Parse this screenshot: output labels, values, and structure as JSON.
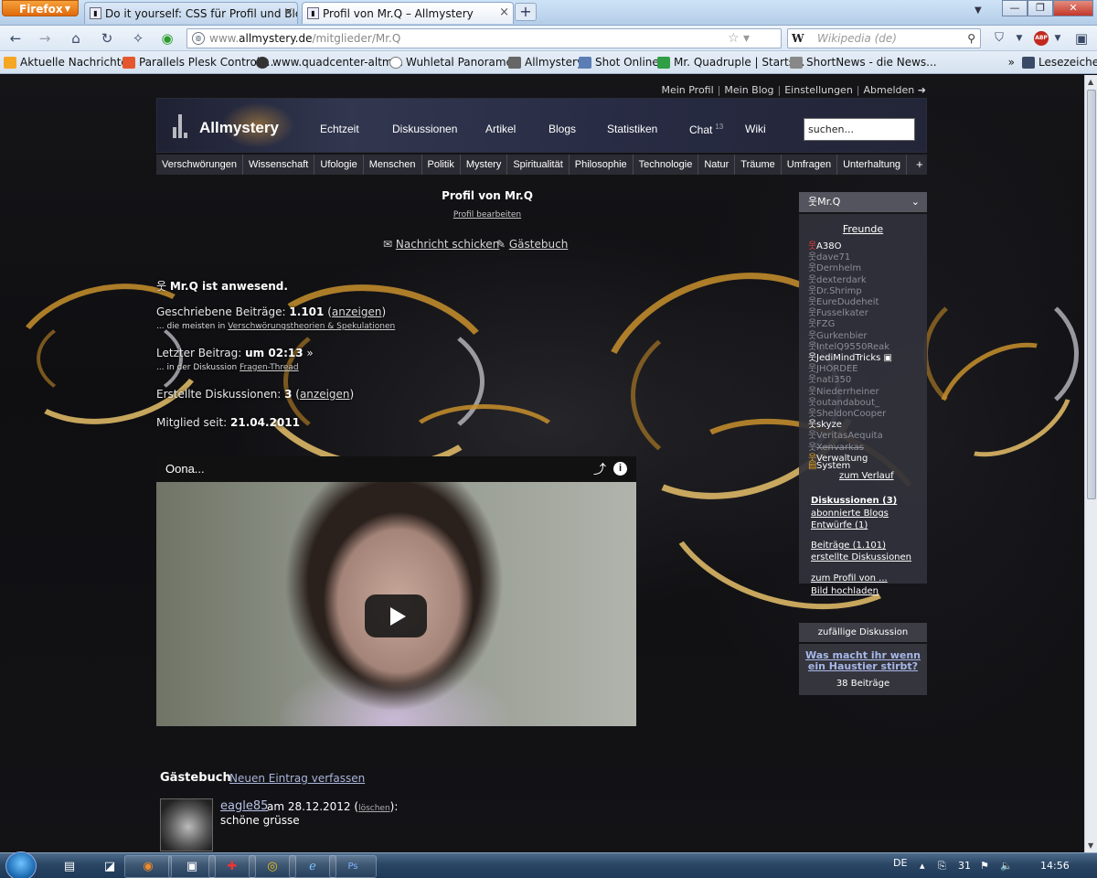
{
  "browser": {
    "menu_label": "Firefox",
    "tabs": [
      {
        "title": "Do it yourself: CSS für Profil und Blog..."
      },
      {
        "title": "Profil von Mr.Q – Allmystery"
      }
    ],
    "url_prefix": "www.",
    "url_domain": "allmystery.de",
    "url_path": "/mitglieder/Mr.Q",
    "search_engine": "W",
    "search_placeholder": "Wikipedia (de)",
    "addon_abp": "ABP",
    "bookmarks": [
      {
        "label": "Aktuelle Nachrichten",
        "color": "#f5a623"
      },
      {
        "label": "Parallels Plesk Control ...",
        "color": "#e4572e"
      },
      {
        "label": "www.quadcenter-altm...",
        "color": "#333333"
      },
      {
        "label": "Wuhletal Panoramen",
        "color": "#777777"
      },
      {
        "label": "Allmystery",
        "color": "#666666"
      },
      {
        "label": "Shot Online",
        "color": "#5b7db5"
      },
      {
        "label": "Mr. Quadruple | Starts...",
        "color": "#2f9e44"
      },
      {
        "label": "ShortNews - die News...",
        "color": "#888888"
      }
    ],
    "bookmarks_more": "»",
    "reading_list": "Lesezeichen"
  },
  "site": {
    "toplinks": [
      "Mein Profil",
      "Mein Blog",
      "Einstellungen",
      "Abmelden ➜"
    ],
    "logo": "Allmystery",
    "nav": [
      {
        "label": "Echtzeit"
      },
      {
        "label": "Diskussionen"
      },
      {
        "label": "Artikel"
      },
      {
        "label": "Blogs"
      },
      {
        "label": "Statistiken"
      },
      {
        "label": "Chat",
        "badge": "13"
      },
      {
        "label": "Wiki"
      }
    ],
    "search_value": "suchen...",
    "categories": [
      "Verschwörungen",
      "Wissenschaft",
      "Ufologie",
      "Menschen",
      "Politik",
      "Mystery",
      "Spiritualität",
      "Philosophie",
      "Technologie",
      "Natur",
      "Träume",
      "Umfragen",
      "Unterhaltung",
      "+"
    ]
  },
  "profile": {
    "title": "Profil von Mr.Q",
    "edit_link": "Profil bearbeiten",
    "message_link": "Nachricht schicken",
    "guestbook_link": "Gästebuch",
    "presence": "Mr.Q ist anwesend.",
    "posts_label": "Geschriebene Beiträge:",
    "posts_value": "1.101",
    "posts_show": "anzeigen",
    "posts_sub_prefix": "... die meisten in",
    "posts_sub_link": "Verschwörungstheorien & Spekulationen",
    "last_post_label": "Letzter Beitrag:",
    "last_post_value": "um 02:13",
    "last_post_sub_prefix": "... in der Diskussion",
    "last_post_sub_link": "Fragen-Thread",
    "threads_label": "Erstellte Diskussionen:",
    "threads_value": "3",
    "threads_show": "anzeigen",
    "member_since_label": "Mitglied seit:",
    "member_since_value": "21.04.2011"
  },
  "video": {
    "title": "Oona...",
    "share_icon": "share-icon",
    "info_icon": "i"
  },
  "guestbook": {
    "heading": "Gästebuch",
    "new_entry": "Neuen Eintrag verfassen",
    "entries": [
      {
        "author": "eagle85",
        "date": "am 28.12.2012",
        "delete": "löschen",
        "text": "schöne grüsse"
      }
    ]
  },
  "sidebar": {
    "user": "Mr.Q",
    "friends_title": "Freunde",
    "friends": [
      {
        "name": "A38O",
        "state": "alert"
      },
      {
        "name": "dave71",
        "state": "off"
      },
      {
        "name": "Dernhelm",
        "state": "off"
      },
      {
        "name": "dexterdark",
        "state": "off"
      },
      {
        "name": "Dr.Shrimp",
        "state": "off"
      },
      {
        "name": "EureDudeheit",
        "state": "off"
      },
      {
        "name": "Fusselkater",
        "state": "off"
      },
      {
        "name": "FZG",
        "state": "off"
      },
      {
        "name": "Gurkenbier",
        "state": "off"
      },
      {
        "name": "IntelQ9550Reak",
        "state": "off"
      },
      {
        "name": "JediMindTricks",
        "state": "on"
      },
      {
        "name": "JHORDEE",
        "state": "off"
      },
      {
        "name": "nati350",
        "state": "off"
      },
      {
        "name": "Niederrheiner",
        "state": "off"
      },
      {
        "name": "outandabout_",
        "state": "off"
      },
      {
        "name": "SheldonCooper",
        "state": "off"
      },
      {
        "name": "skyze",
        "state": "on"
      },
      {
        "name": "VeritasAequita",
        "state": "off"
      },
      {
        "name": "Xenvarkas",
        "state": "strike"
      },
      {
        "name": "Verwaltung",
        "state": "admin"
      },
      {
        "name": "System",
        "state": "system"
      }
    ],
    "history_link": "zum Verlauf",
    "links": [
      {
        "label": "Diskussionen (3)",
        "bold": true
      },
      {
        "label": "abonnierte Blogs",
        "bold": false
      },
      {
        "label": "Entwürfe (1)",
        "bold": false
      },
      {
        "label": "Beiträge (1.101)",
        "bold": false
      },
      {
        "label": "erstellte Diskussionen",
        "bold": false
      },
      {
        "label": "zum Profil von ...",
        "bold": false
      },
      {
        "label": "Bild hochladen",
        "bold": false
      }
    ],
    "random_heading": "zufällige Diskussion",
    "random_title_line1": "Was macht ihr wenn",
    "random_title_line2": "ein Haustier stirbt?",
    "random_count": "38 Beiträge"
  },
  "taskbar": {
    "lang": "DE",
    "clock": "14:56"
  },
  "colors": {
    "accent_gold": "#c8902c",
    "header_bg": "#343a54",
    "sidebar_bg": "#32323c"
  }
}
